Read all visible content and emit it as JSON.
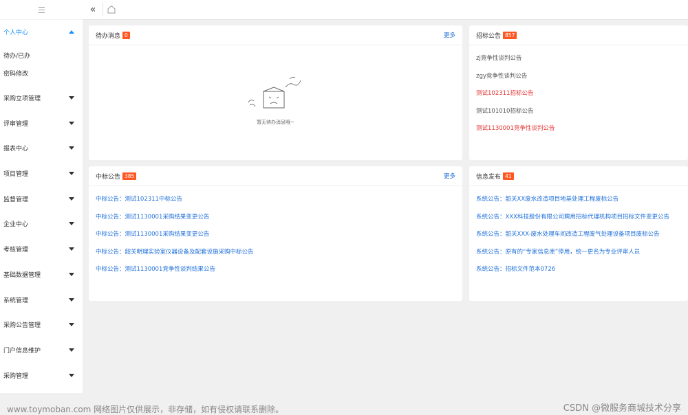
{
  "sidebar": {
    "items": [
      {
        "label": "个人中心",
        "active": true,
        "expanded": true
      },
      {
        "label": "待办/已办"
      },
      {
        "label": "密码修改"
      },
      {
        "label": "采购立项管理"
      },
      {
        "label": "评审管理"
      },
      {
        "label": "报表中心"
      },
      {
        "label": "项目管理"
      },
      {
        "label": "监督管理"
      },
      {
        "label": "企业中心"
      },
      {
        "label": "考核管理"
      },
      {
        "label": "基础数据管理"
      },
      {
        "label": "系统管理"
      },
      {
        "label": "采购公告管理"
      },
      {
        "label": "门户信息维护"
      },
      {
        "label": "采购管理"
      }
    ]
  },
  "topbar": {
    "collapse_icon": "double-chevron-left-icon",
    "home_icon": "home-icon"
  },
  "cards": {
    "todo": {
      "title": "待办消息",
      "badge": "0",
      "more": "更多",
      "empty": "暂无待办消息哦~"
    },
    "bidding": {
      "title": "招标公告",
      "badge": "857",
      "items": [
        {
          "text": "zj竞争性谈判公告",
          "color": "gray"
        },
        {
          "text": "zgy竞争性谈判公告",
          "color": "gray"
        },
        {
          "text": "测试102311招标公告",
          "color": "red"
        },
        {
          "text": "测试101010招标公告",
          "color": "gray"
        },
        {
          "text": "测试1130001竞争性谈判公告",
          "color": "red"
        }
      ]
    },
    "award": {
      "title": "中标公告",
      "badge": "385",
      "more": "更多",
      "items": [
        "中标公告：测试102311中标公告",
        "中标公告：测试1130001采购结果变更公告",
        "中标公告：测试1130001采购结果变更公告",
        "中标公告：韶关明理实验室仪器设备及配套设施采购中标公告",
        "中标公告：测试1130001竞争性谈判结果公告"
      ]
    },
    "info": {
      "title": "信息发布",
      "badge": "41",
      "items": [
        "系统公告：韶关XX废水改造项目地基处理工程废标公告",
        "系统公告：XXX科技股份有限公司聘用招标代理机构项目招标文件变更公告",
        "系统公告：韶关XXX-废水处理车间改造工程废气处理设备项目废标公告",
        "系统公告：原有的“专家信息库”停用，统一更名为专业评审人员",
        "系统公告：招标文件范本0726"
      ]
    }
  },
  "watermark": {
    "left": "www.toymoban.com 网络图片仅供展示，非存储，如有侵权请联系删除。",
    "right": "CSDN @微服务商城技术分享"
  },
  "colors": {
    "accent": "#1890ff",
    "badge": "#ff5722",
    "link": "#1e6fd9",
    "alert": "#e53935"
  }
}
